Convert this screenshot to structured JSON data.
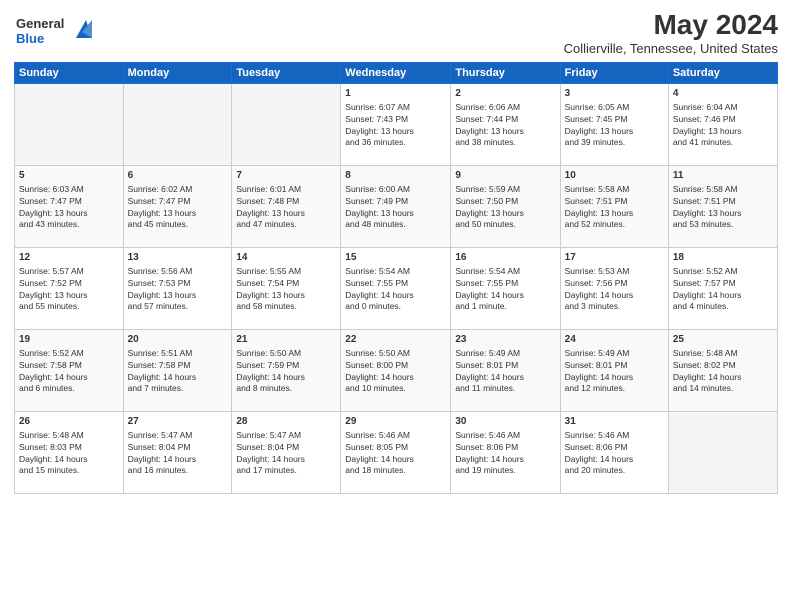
{
  "header": {
    "logo_line1": "General",
    "logo_line2": "Blue",
    "title": "May 2024",
    "subtitle": "Collierville, Tennessee, United States"
  },
  "weekdays": [
    "Sunday",
    "Monday",
    "Tuesday",
    "Wednesday",
    "Thursday",
    "Friday",
    "Saturday"
  ],
  "weeks": [
    [
      {
        "day": "",
        "info": ""
      },
      {
        "day": "",
        "info": ""
      },
      {
        "day": "",
        "info": ""
      },
      {
        "day": "1",
        "info": "Sunrise: 6:07 AM\nSunset: 7:43 PM\nDaylight: 13 hours\nand 36 minutes."
      },
      {
        "day": "2",
        "info": "Sunrise: 6:06 AM\nSunset: 7:44 PM\nDaylight: 13 hours\nand 38 minutes."
      },
      {
        "day": "3",
        "info": "Sunrise: 6:05 AM\nSunset: 7:45 PM\nDaylight: 13 hours\nand 39 minutes."
      },
      {
        "day": "4",
        "info": "Sunrise: 6:04 AM\nSunset: 7:46 PM\nDaylight: 13 hours\nand 41 minutes."
      }
    ],
    [
      {
        "day": "5",
        "info": "Sunrise: 6:03 AM\nSunset: 7:47 PM\nDaylight: 13 hours\nand 43 minutes."
      },
      {
        "day": "6",
        "info": "Sunrise: 6:02 AM\nSunset: 7:47 PM\nDaylight: 13 hours\nand 45 minutes."
      },
      {
        "day": "7",
        "info": "Sunrise: 6:01 AM\nSunset: 7:48 PM\nDaylight: 13 hours\nand 47 minutes."
      },
      {
        "day": "8",
        "info": "Sunrise: 6:00 AM\nSunset: 7:49 PM\nDaylight: 13 hours\nand 48 minutes."
      },
      {
        "day": "9",
        "info": "Sunrise: 5:59 AM\nSunset: 7:50 PM\nDaylight: 13 hours\nand 50 minutes."
      },
      {
        "day": "10",
        "info": "Sunrise: 5:58 AM\nSunset: 7:51 PM\nDaylight: 13 hours\nand 52 minutes."
      },
      {
        "day": "11",
        "info": "Sunrise: 5:58 AM\nSunset: 7:51 PM\nDaylight: 13 hours\nand 53 minutes."
      }
    ],
    [
      {
        "day": "12",
        "info": "Sunrise: 5:57 AM\nSunset: 7:52 PM\nDaylight: 13 hours\nand 55 minutes."
      },
      {
        "day": "13",
        "info": "Sunrise: 5:56 AM\nSunset: 7:53 PM\nDaylight: 13 hours\nand 57 minutes."
      },
      {
        "day": "14",
        "info": "Sunrise: 5:55 AM\nSunset: 7:54 PM\nDaylight: 13 hours\nand 58 minutes."
      },
      {
        "day": "15",
        "info": "Sunrise: 5:54 AM\nSunset: 7:55 PM\nDaylight: 14 hours\nand 0 minutes."
      },
      {
        "day": "16",
        "info": "Sunrise: 5:54 AM\nSunset: 7:55 PM\nDaylight: 14 hours\nand 1 minute."
      },
      {
        "day": "17",
        "info": "Sunrise: 5:53 AM\nSunset: 7:56 PM\nDaylight: 14 hours\nand 3 minutes."
      },
      {
        "day": "18",
        "info": "Sunrise: 5:52 AM\nSunset: 7:57 PM\nDaylight: 14 hours\nand 4 minutes."
      }
    ],
    [
      {
        "day": "19",
        "info": "Sunrise: 5:52 AM\nSunset: 7:58 PM\nDaylight: 14 hours\nand 6 minutes."
      },
      {
        "day": "20",
        "info": "Sunrise: 5:51 AM\nSunset: 7:58 PM\nDaylight: 14 hours\nand 7 minutes."
      },
      {
        "day": "21",
        "info": "Sunrise: 5:50 AM\nSunset: 7:59 PM\nDaylight: 14 hours\nand 8 minutes."
      },
      {
        "day": "22",
        "info": "Sunrise: 5:50 AM\nSunset: 8:00 PM\nDaylight: 14 hours\nand 10 minutes."
      },
      {
        "day": "23",
        "info": "Sunrise: 5:49 AM\nSunset: 8:01 PM\nDaylight: 14 hours\nand 11 minutes."
      },
      {
        "day": "24",
        "info": "Sunrise: 5:49 AM\nSunset: 8:01 PM\nDaylight: 14 hours\nand 12 minutes."
      },
      {
        "day": "25",
        "info": "Sunrise: 5:48 AM\nSunset: 8:02 PM\nDaylight: 14 hours\nand 14 minutes."
      }
    ],
    [
      {
        "day": "26",
        "info": "Sunrise: 5:48 AM\nSunset: 8:03 PM\nDaylight: 14 hours\nand 15 minutes."
      },
      {
        "day": "27",
        "info": "Sunrise: 5:47 AM\nSunset: 8:04 PM\nDaylight: 14 hours\nand 16 minutes."
      },
      {
        "day": "28",
        "info": "Sunrise: 5:47 AM\nSunset: 8:04 PM\nDaylight: 14 hours\nand 17 minutes."
      },
      {
        "day": "29",
        "info": "Sunrise: 5:46 AM\nSunset: 8:05 PM\nDaylight: 14 hours\nand 18 minutes."
      },
      {
        "day": "30",
        "info": "Sunrise: 5:46 AM\nSunset: 8:06 PM\nDaylight: 14 hours\nand 19 minutes."
      },
      {
        "day": "31",
        "info": "Sunrise: 5:46 AM\nSunset: 8:06 PM\nDaylight: 14 hours\nand 20 minutes."
      },
      {
        "day": "",
        "info": ""
      }
    ]
  ]
}
